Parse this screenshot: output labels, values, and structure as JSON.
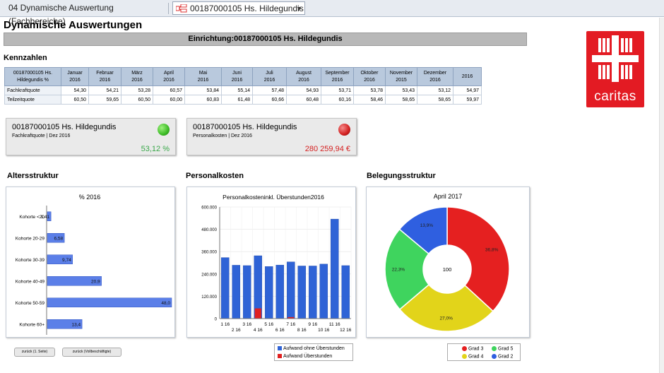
{
  "tabs": {
    "tab1": "04 Dynamische Auswertung (Fachbereiche)",
    "tab2": "00187000105 Hs. Hildegundis"
  },
  "page": {
    "title": "Dynamische Auswertungen",
    "banner": "Einrichtung:00187000105 Hs. Hildegundis",
    "logo_text": "caritas"
  },
  "kennzahlen": {
    "heading": "Kennzahlen",
    "header_label_1": "00187000105 Hs.",
    "header_label_2": "Hildegundis %",
    "columns": [
      [
        "Januar",
        "2016"
      ],
      [
        "Februar",
        "2016"
      ],
      [
        "März",
        "2016"
      ],
      [
        "April",
        "2016"
      ],
      [
        "Mai",
        "2016"
      ],
      [
        "Juni",
        "2016"
      ],
      [
        "Juli",
        "2016"
      ],
      [
        "August",
        "2016"
      ],
      [
        "September",
        "2016"
      ],
      [
        "Oktober",
        "2016"
      ],
      [
        "November",
        "2015"
      ],
      [
        "Dezember",
        "2016"
      ],
      [
        "2016",
        ""
      ]
    ],
    "rows": [
      {
        "label": "Fachkraftquote",
        "values": [
          "54,30",
          "54,21",
          "53,28",
          "60,57",
          "53,84",
          "55,14",
          "57,48",
          "54,93",
          "53,71",
          "53,78",
          "53,43",
          "53,12",
          "54,97"
        ]
      },
      {
        "label": "Teilzeitquote",
        "values": [
          "60,50",
          "59,65",
          "60,50",
          "60,00",
          "60,83",
          "61,48",
          "60,66",
          "60,48",
          "60,16",
          "58,46",
          "58,65",
          "58,65",
          "59,97"
        ]
      }
    ]
  },
  "kpis": [
    {
      "title": "00187000105 Hs. Hildegundis",
      "sub": "Fachkraftquote | Dez 2016",
      "value": "53,12 %",
      "light": "#3dbb26",
      "value_color": "#3aa84a"
    },
    {
      "title": "00187000105 Hs. Hildegundis",
      "sub": "Personalkosten | Dez 2016",
      "value": "280 259,94 €",
      "light": "#d21f1f",
      "value_color": "#d42020"
    }
  ],
  "sections": {
    "alter": "Altersstruktur",
    "personal": "Personalkosten",
    "belegung": "Belegungsstruktur"
  },
  "buttons": {
    "back1": "zurück (1. Seite)",
    "back2": "zurück (Vollbeschäftigte)"
  },
  "chart_data": [
    {
      "type": "bar",
      "orientation": "horizontal",
      "title": "% 2016",
      "categories": [
        "Kohorte <20",
        "Kohorte 20-29",
        "Kohorte 30-39",
        "Kohorte 40-49",
        "Kohorte 50-59",
        "Kohorte 60+"
      ],
      "values": [
        1.41,
        6.58,
        9.74,
        20.9,
        48.0,
        13.4
      ],
      "value_labels": [
        "1,41",
        "6,58",
        "9,74",
        "20,9",
        "48,0",
        "13,4"
      ],
      "xlim": [
        0,
        48
      ],
      "color": "#5b7fe8"
    },
    {
      "type": "bar",
      "title": "Personalkosteninkl. Überstunden2016",
      "categories": [
        "1 16",
        "2 16",
        "3 16",
        "4 16",
        "5 16",
        "6 16",
        "7 16",
        "8 16",
        "9 16",
        "10 16",
        "11 16",
        "12 16"
      ],
      "y_ticks": [
        "0",
        "120.000",
        "240.000",
        "360.000",
        "480.000",
        "600.000"
      ],
      "ylim": [
        0,
        600000
      ],
      "series": [
        {
          "name": "Aufwand ohne Überstunden",
          "color": "#2f63d6",
          "values": [
            328000,
            287000,
            285000,
            338000,
            280000,
            288000,
            305000,
            283000,
            283000,
            293000,
            535000,
            285000
          ]
        },
        {
          "name": "Aufwand Überstunden",
          "color": "#e02020",
          "values": [
            0,
            0,
            0,
            55000,
            0,
            0,
            8000,
            0,
            0,
            0,
            0,
            0
          ]
        }
      ]
    },
    {
      "type": "pie",
      "subtype": "donut",
      "title": "April 2017",
      "center_label": "100",
      "slices": [
        {
          "name": "Grad 3",
          "value": 36.8,
          "label": "36,8%",
          "color": "#e52020"
        },
        {
          "name": "Grad 4",
          "value": 27.0,
          "label": "27,0%",
          "color": "#e2d41a"
        },
        {
          "name": "Grad 5",
          "value": 22.3,
          "label": "22,3%",
          "color": "#3fd45e"
        },
        {
          "name": "Grad 2",
          "value": 13.9,
          "label": "13,9%",
          "color": "#2f5fe0"
        }
      ],
      "legend": [
        "Grad 3",
        "Grad 5",
        "Grad 4",
        "Grad 2"
      ]
    }
  ]
}
